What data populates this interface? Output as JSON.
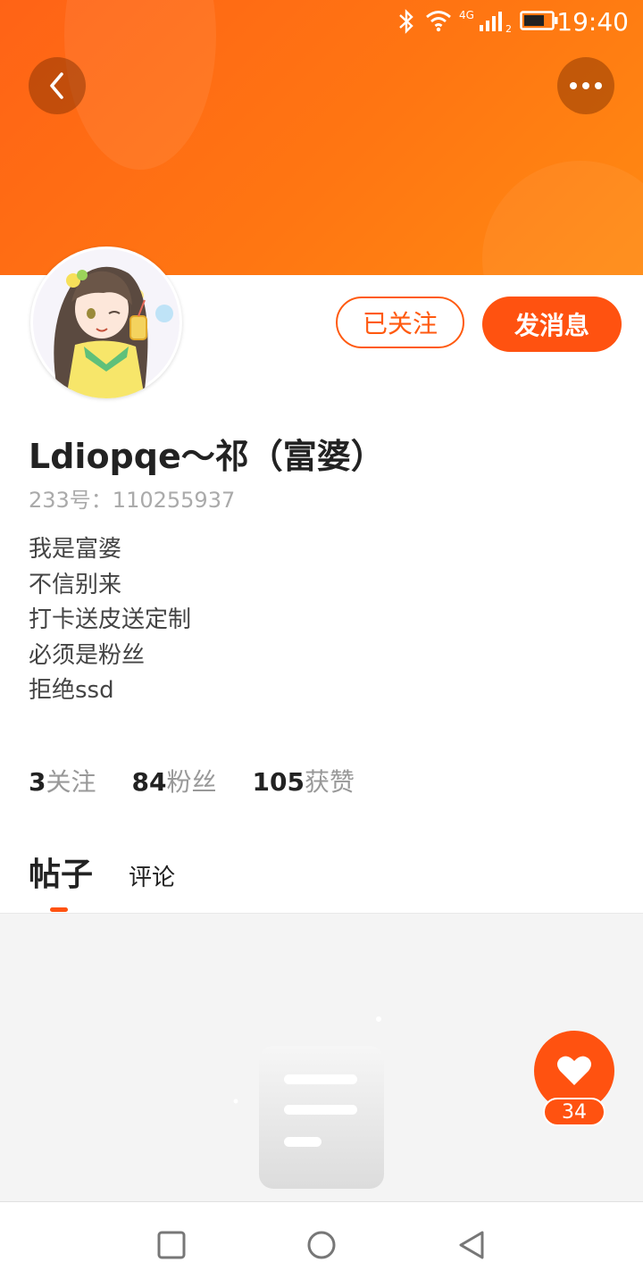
{
  "status_bar": {
    "time": "19:40",
    "network": "4G",
    "sim_slot": "2",
    "icons": [
      "bluetooth-icon",
      "wifi-icon",
      "signal-icon",
      "battery-icon"
    ]
  },
  "header": {
    "back_icon": "chevron-left-icon",
    "more_icon": "more-dots-icon",
    "color": "#ff6a14"
  },
  "profile": {
    "username": "Ldiopqe～祁（富婆）",
    "uid": "233号：110255937",
    "bio": [
      "我是富婆",
      "不信别来",
      "打卡送皮送定制",
      "必须是粉丝",
      "拒绝ssd"
    ],
    "follow_button": "已关注",
    "message_button": "发消息"
  },
  "stats": {
    "following_count": "3",
    "following_label": "关注",
    "fans_count": "84",
    "fans_label": "粉丝",
    "likes_count": "105",
    "likes_label": "获赞"
  },
  "tabs": {
    "posts": "帖子",
    "comments": "评论",
    "active": "帖子"
  },
  "like_fab": {
    "count": "34",
    "icon": "heart-icon"
  },
  "navbar": {
    "icons": [
      "recent-apps-icon",
      "home-icon",
      "back-icon"
    ]
  },
  "accent_color": "#ff5210"
}
